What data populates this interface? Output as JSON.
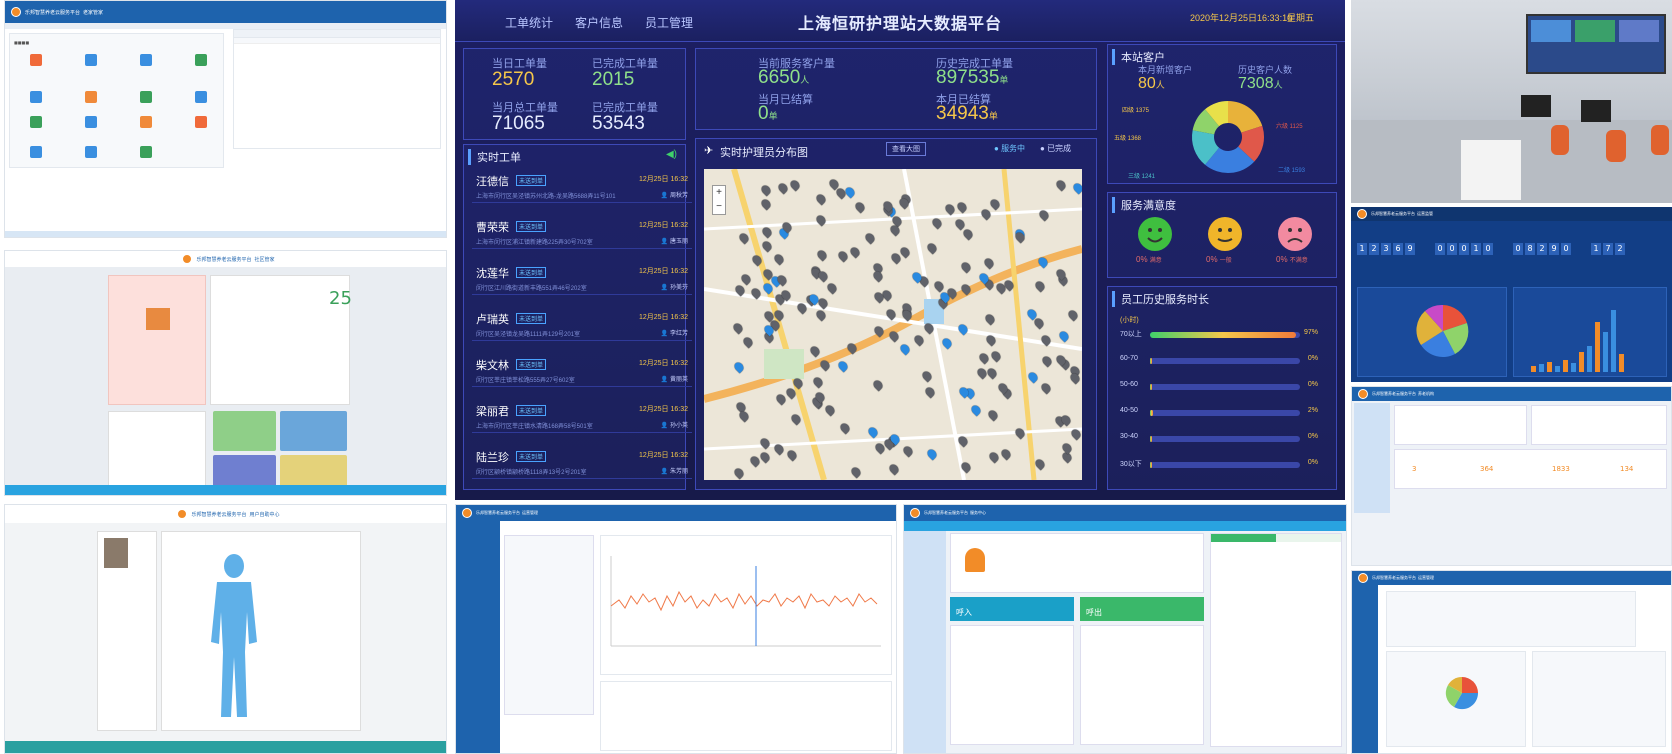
{
  "dashboard": {
    "nav_tabs": [
      "工单统计",
      "客户信息",
      "员工管理"
    ],
    "title": "上海恒研护理站大数据平台",
    "datetime": "2020年12月25日16:33:10",
    "weekday": "星期五",
    "stats_left": [
      {
        "label": "当日工单量",
        "value": "2570"
      },
      {
        "label": "已完成工单量",
        "value": "2015"
      },
      {
        "label": "当月总工单量",
        "value": "71065"
      },
      {
        "label": "已完成工单量",
        "value": "53543"
      }
    ],
    "stats_center": [
      {
        "label": "当前服务客户量",
        "value": "6650",
        "unit": "人"
      },
      {
        "label": "历史完成工单量",
        "value": "897535",
        "unit": "单"
      },
      {
        "label": "当月已结算",
        "value": "0",
        "unit": "单"
      },
      {
        "label": "本月已结算",
        "value": "34943",
        "unit": "单"
      }
    ],
    "work_orders_title": "实时工单",
    "work_order_tag": "未送到单",
    "work_orders": [
      {
        "name": "汪德信",
        "time": "12月25日 16:32",
        "addr": "上海市闵行区吴泾镇苏州北路-龙吴路5688弄11号101",
        "staff": "周秋芳"
      },
      {
        "name": "曹荣荣",
        "time": "12月25日 16:32",
        "addr": "上海市闵行区浦江镇新建路225弄30号702室",
        "staff": "唐玉丽"
      },
      {
        "name": "沈莲华",
        "time": "12月25日 16:32",
        "addr": "闵行区江川路街道新丰路551弄46号202室",
        "staff": "孙美芬"
      },
      {
        "name": "卢瑞英",
        "time": "12月25日 16:32",
        "addr": "闵行区吴泾镇龙吴路1111弄129号201室",
        "staff": "李红芳"
      },
      {
        "name": "柴文林",
        "time": "12月25日 16:32",
        "addr": "闵行区莘庄镇莘松路555弄27号602室",
        "staff": "黄丽英"
      },
      {
        "name": "梁丽君",
        "time": "12月25日 16:32",
        "addr": "上海市闵行区莘庄镇水清路168弄58号501室",
        "staff": "孙小英"
      },
      {
        "name": "陆兰珍",
        "time": "12月25日 16:32",
        "addr": "闵行区颛桥镇颛桥路1118弄13号2号201室",
        "staff": "朱芳丽"
      }
    ],
    "map_title": "实时护理员分布图",
    "map_button": "查看大图",
    "map_legend": [
      "服务中",
      "已完成"
    ],
    "customers_title": "本站客户",
    "customers": [
      {
        "label": "本月新增客户",
        "value": "80",
        "unit": "人"
      },
      {
        "label": "历史客户人数",
        "value": "7308",
        "unit": "人"
      }
    ],
    "donut_slices": [
      {
        "label": "一级",
        "value": 20,
        "color": "#e8b23a"
      },
      {
        "label": "六级",
        "value": 17,
        "color": "#e0584a"
      },
      {
        "label": "二级",
        "value": 24,
        "color": "#3a7fe0"
      },
      {
        "label": "三级",
        "value": 17,
        "color": "#4bc0c8"
      },
      {
        "label": "五级",
        "value": 11,
        "color": "#8fd36a"
      },
      {
        "label": "四级",
        "value": 11,
        "color": "#e8e04a"
      }
    ],
    "donut_labels": [
      "四级 1375",
      "六级 1125",
      "五级 1368",
      "二级 1593",
      "三级 1241"
    ],
    "donut_pcts": [
      "20%",
      "17%",
      "24%",
      "17%",
      "11%"
    ],
    "satisfaction_title": "服务满意度",
    "satisfaction": [
      {
        "pct": "0%",
        "label": "满意",
        "color": "#3fbf3f"
      },
      {
        "pct": "0%",
        "label": "一般",
        "color": "#f0b52a"
      },
      {
        "pct": "0%",
        "label": "不满意",
        "color": "#f28aa0"
      }
    ],
    "service_hours_title": "员工历史服务时长",
    "service_unit": "(小时)",
    "service_bars": [
      {
        "label": "70以上",
        "pct": "97%",
        "level": 0.97
      },
      {
        "label": "60-70",
        "pct": "0%",
        "level": 0.0
      },
      {
        "label": "50-60",
        "pct": "0%",
        "level": 0.0
      },
      {
        "label": "40-50",
        "pct": "2%",
        "level": 0.02
      },
      {
        "label": "30-40",
        "pct": "0%",
        "level": 0.0
      },
      {
        "label": "30以下",
        "pct": "0%",
        "level": 0.0
      }
    ]
  },
  "app_title": "乐邦智慧养老云服务平台",
  "panels": {
    "p1_sub": "老家管家",
    "p2_sub": "社区管家",
    "p3_sub": "用户自助中心",
    "p4_sub": "运营管理",
    "p5_sub": "服务中心",
    "p6_sub": "运营监管",
    "p7_sub": "养老机构",
    "p8_sub": "运营管理",
    "calendar_day": "25",
    "counters": [
      "1",
      "2",
      "3",
      "6",
      "9",
      "0",
      "0",
      "0",
      "1",
      "0",
      "0",
      "8",
      "2",
      "9",
      "0",
      "1",
      "7",
      "2"
    ],
    "p5_big_labels": [
      "呼入",
      "呼出"
    ],
    "p7_counts": [
      "3",
      "364",
      "1833",
      "134"
    ]
  }
}
